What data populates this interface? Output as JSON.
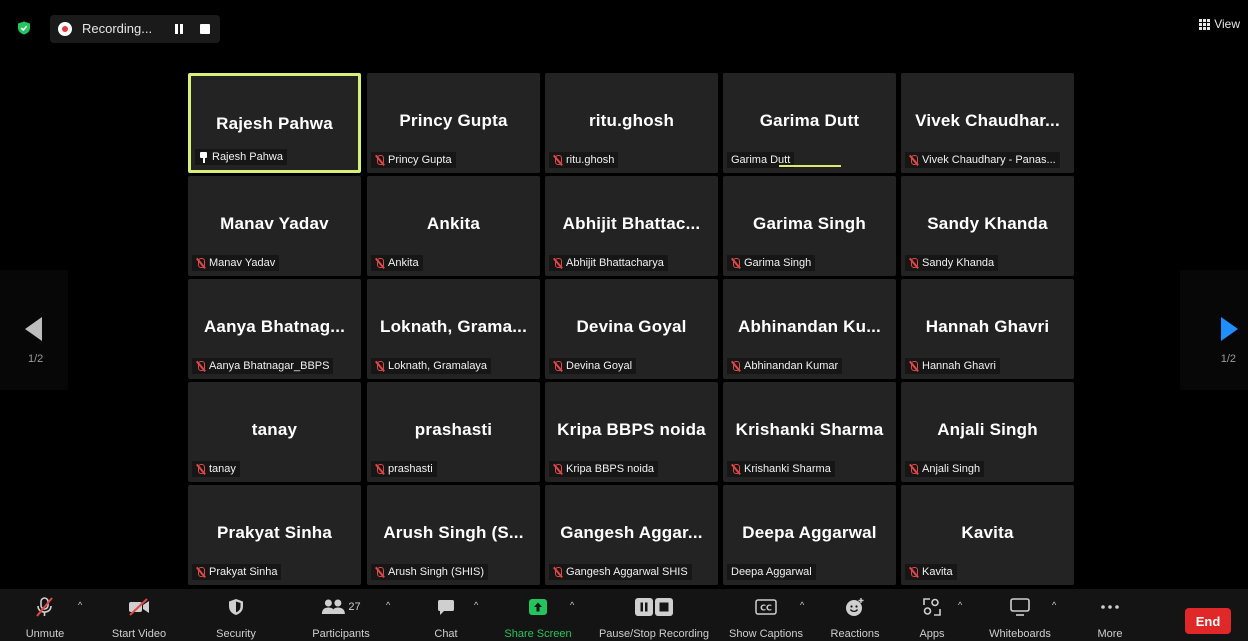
{
  "recording": {
    "label": "Recording..."
  },
  "view_button": {
    "label": "View"
  },
  "nav": {
    "left_page": "1/2",
    "right_page": "1/2"
  },
  "participants": [
    {
      "display": "Rajesh Pahwa",
      "label": "Rajesh Pahwa",
      "icon": "pin",
      "active": true
    },
    {
      "display": "Princy Gupta",
      "label": "Princy Gupta",
      "icon": "mic-muted"
    },
    {
      "display": "ritu.ghosh",
      "label": "ritu.ghosh",
      "icon": "mic-muted"
    },
    {
      "display": "Garima Dutt",
      "label": "Garima Dutt",
      "icon": "none",
      "speaking": true
    },
    {
      "display": "Vivek Chaudhar...",
      "label": "Vivek Chaudhary - Panas...",
      "icon": "mic-muted"
    },
    {
      "display": "Manav Yadav",
      "label": "Manav Yadav",
      "icon": "mic-muted"
    },
    {
      "display": "Ankita",
      "label": "Ankita",
      "icon": "mic-muted"
    },
    {
      "display": "Abhijit Bhattac...",
      "label": "Abhijit Bhattacharya",
      "icon": "mic-muted"
    },
    {
      "display": "Garima Singh",
      "label": "Garima Singh",
      "icon": "mic-muted"
    },
    {
      "display": "Sandy Khanda",
      "label": "Sandy Khanda",
      "icon": "mic-muted"
    },
    {
      "display": "Aanya Bhatnag...",
      "label": "Aanya Bhatnagar_BBPS",
      "icon": "mic-muted"
    },
    {
      "display": "Loknath, Grama...",
      "label": "Loknath, Gramalaya",
      "icon": "mic-muted"
    },
    {
      "display": "Devina Goyal",
      "label": "Devina Goyal",
      "icon": "mic-muted"
    },
    {
      "display": "Abhinandan Ku...",
      "label": "Abhinandan Kumar",
      "icon": "mic-muted"
    },
    {
      "display": "Hannah Ghavri",
      "label": "Hannah Ghavri",
      "icon": "mic-muted"
    },
    {
      "display": "tanay",
      "label": "tanay",
      "icon": "mic-muted"
    },
    {
      "display": "prashasti",
      "label": "prashasti",
      "icon": "mic-muted"
    },
    {
      "display": "Kripa BBPS noida",
      "label": "Kripa BBPS noida",
      "icon": "mic-muted"
    },
    {
      "display": "Krishanki Sharma",
      "label": "Krishanki Sharma",
      "icon": "mic-muted"
    },
    {
      "display": "Anjali Singh",
      "label": "Anjali Singh",
      "icon": "mic-muted"
    },
    {
      "display": "Prakyat Sinha",
      "label": "Prakyat Sinha",
      "icon": "mic-muted"
    },
    {
      "display": "Arush Singh (S...",
      "label": "Arush Singh (SHIS)",
      "icon": "mic-muted"
    },
    {
      "display": "Gangesh Aggar...",
      "label": "Gangesh Aggarwal SHIS",
      "icon": "mic-muted"
    },
    {
      "display": "Deepa Aggarwal",
      "label": "Deepa Aggarwal",
      "icon": "none"
    },
    {
      "display": "Kavita",
      "label": "Kavita",
      "icon": "mic-muted"
    }
  ],
  "toolbar": {
    "unmute": "Unmute",
    "start_video": "Start Video",
    "security": "Security",
    "participants": "Participants",
    "participants_count": "27",
    "chat": "Chat",
    "share_screen": "Share Screen",
    "pause_stop_recording": "Pause/Stop Recording",
    "show_captions": "Show Captions",
    "reactions": "Reactions",
    "apps": "Apps",
    "whiteboards": "Whiteboards",
    "more": "More",
    "end": "End"
  },
  "colors": {
    "active_border": "#d8f07a",
    "share_screen_green": "#22c55e",
    "end_red": "#e02828",
    "muted_red": "#e04747",
    "next_arrow_blue": "#1f8fff"
  }
}
